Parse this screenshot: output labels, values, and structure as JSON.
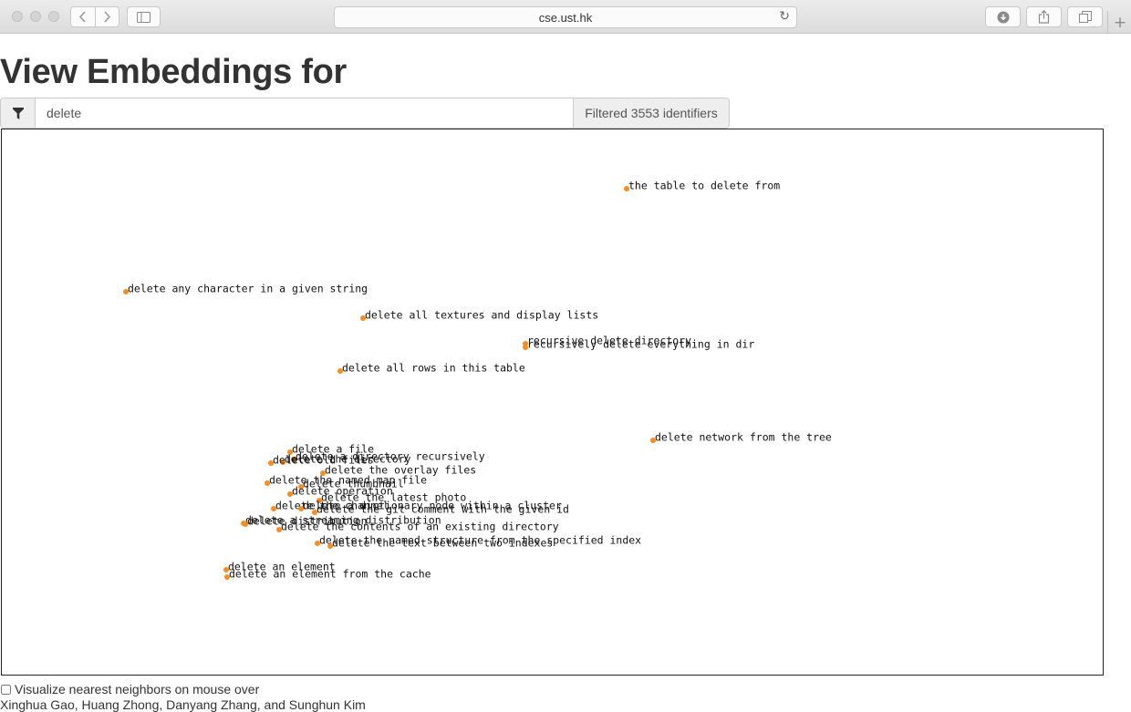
{
  "browser": {
    "url": "cse.ust.hk",
    "controls": {
      "back_icon": "chevron-left-icon",
      "forward_icon": "chevron-right-icon",
      "sidebar_icon": "sidebar-icon",
      "reload_icon": "reload-icon",
      "download_icon": "download-icon",
      "share_icon": "share-icon",
      "tabs_icon": "tabs-overview-icon",
      "new_tab_icon": "plus-icon"
    }
  },
  "page": {
    "title": "View Embeddings for",
    "filter": {
      "icon": "filter-icon",
      "value": "delete",
      "count_label": "Filtered 3553 identifiers"
    },
    "nearest_neighbors_label": "Visualize nearest neighbors on mouse over",
    "footer_text": "Xinghua Gao, Huang Zhong, Danyang Zhang, and Sunghun Kim"
  },
  "accent_color": "#ff8c1a",
  "points": [
    {
      "label": "the table to delete from"
    },
    {
      "label": "delete any character in a given string"
    },
    {
      "label": "delete all textures and display lists"
    },
    {
      "label": "recursive delete directory"
    },
    {
      "label": "recursively delete everything in dir"
    },
    {
      "label": "delete all rows in this table"
    },
    {
      "label": "delete network from the tree"
    },
    {
      "label": "delete a file"
    },
    {
      "label": "delete a directory recursively"
    },
    {
      "label": "delete the directory"
    },
    {
      "label": "delete old files"
    },
    {
      "label": "delete the overlay files"
    },
    {
      "label": "delete the named map file"
    },
    {
      "label": "delete thumbnail"
    },
    {
      "label": "delete operation"
    },
    {
      "label": "delete the latest photo"
    },
    {
      "label": "delete the channel"
    },
    {
      "label": "delete a dictionary node within a cluster"
    },
    {
      "label": "delete the git comment with the given id"
    },
    {
      "label": "delete a streaming distribution"
    },
    {
      "label": "delete distribution"
    },
    {
      "label": "delete the contents of an existing directory"
    },
    {
      "label": "delete the named structure from the specified index"
    },
    {
      "label": "delete the text between two indexes"
    },
    {
      "label": "delete an element"
    },
    {
      "label": "delete an element from the cache"
    }
  ]
}
